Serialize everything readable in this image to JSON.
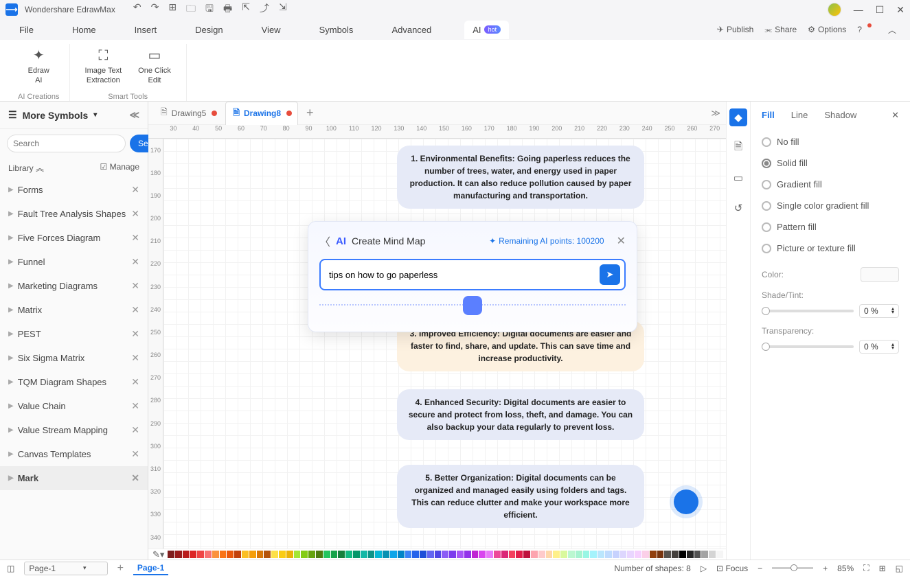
{
  "app": {
    "title": "Wondershare EdrawMax"
  },
  "menu": {
    "items": [
      "File",
      "Home",
      "Insert",
      "Design",
      "View",
      "Symbols",
      "Advanced"
    ],
    "ai_label": "AI",
    "hot": "hot",
    "right": {
      "publish": "Publish",
      "share": "Share",
      "options": "Options"
    }
  },
  "ribbon": {
    "edraw_ai": "Edraw\nAI",
    "group1": "AI Creations",
    "image_text": "Image Text\nExtraction",
    "one_click": "One Click\nEdit",
    "group2": "Smart Tools"
  },
  "sidebar": {
    "title": "More Symbols",
    "search_placeholder": "Search",
    "search_btn": "Search",
    "library": "Library",
    "manage": "Manage",
    "items": [
      "Forms",
      "Fault Tree Analysis Shapes",
      "Five Forces Diagram",
      "Funnel",
      "Marketing Diagrams",
      "Matrix",
      "PEST",
      "Six Sigma Matrix",
      "TQM Diagram Shapes",
      "Value Chain",
      "Value Stream Mapping",
      "Canvas Templates",
      "Mark"
    ]
  },
  "tabs": {
    "t1": "Drawing5",
    "t2": "Drawing8"
  },
  "ruler_h": [
    "30",
    "40",
    "50",
    "60",
    "70",
    "80",
    "90",
    "100",
    "110",
    "120",
    "130",
    "140",
    "150",
    "160",
    "170",
    "180",
    "190",
    "200",
    "210",
    "220",
    "230",
    "240",
    "250",
    "260",
    "270"
  ],
  "ruler_v": [
    "170",
    "180",
    "190",
    "200",
    "210",
    "220",
    "230",
    "240",
    "250",
    "260",
    "270",
    "280",
    "290",
    "300",
    "310",
    "320",
    "330",
    "340"
  ],
  "nodes": {
    "n1": "1. Environmental Benefits: Going paperless reduces the number of trees, water, and energy used in paper production. It can also reduce pollution caused by paper manufacturing and transportation.",
    "n3": "3. Improved Efficiency: Digital documents are easier and faster to find, share, and update. This can save time and increase productivity.",
    "n4": "4. Enhanced Security: Digital documents are easier to secure and protect from loss, theft, and damage. You can also backup your data regularly to prevent loss.",
    "n5": "5. Better Organization: Digital documents can be organized and managed easily using folders and tags. This can reduce clutter and make your workspace more efficient."
  },
  "ai_modal": {
    "title": "Create Mind Map",
    "points": "Remaining AI points: 100200",
    "input": "tips on how to go paperless"
  },
  "props": {
    "tabs": {
      "fill": "Fill",
      "line": "Line",
      "shadow": "Shadow"
    },
    "opts": {
      "nofill": "No fill",
      "solid": "Solid fill",
      "gradient": "Gradient fill",
      "single": "Single color gradient fill",
      "pattern": "Pattern fill",
      "picture": "Picture or texture fill"
    },
    "color": "Color:",
    "shade": "Shade/Tint:",
    "transparency": "Transparency:",
    "shade_val": "0 %",
    "trans_val": "0 %"
  },
  "status": {
    "page_select": "Page-1",
    "page_tab": "Page-1",
    "shapes": "Number of shapes: 8",
    "focus": "Focus",
    "zoom": "85%"
  },
  "colors": [
    "#7f1d1d",
    "#991b1b",
    "#b91c1c",
    "#dc2626",
    "#ef4444",
    "#f87171",
    "#fb923c",
    "#f97316",
    "#ea580c",
    "#c2410c",
    "#fbbf24",
    "#f59e0b",
    "#d97706",
    "#b45309",
    "#fde047",
    "#facc15",
    "#eab308",
    "#a3e635",
    "#84cc16",
    "#65a30d",
    "#4d7c0f",
    "#22c55e",
    "#16a34a",
    "#15803d",
    "#10b981",
    "#059669",
    "#14b8a6",
    "#0d9488",
    "#06b6d4",
    "#0891b2",
    "#0ea5e9",
    "#0284c7",
    "#3b82f6",
    "#2563eb",
    "#1d4ed8",
    "#6366f1",
    "#4f46e5",
    "#8b5cf6",
    "#7c3aed",
    "#a855f7",
    "#9333ea",
    "#c026d3",
    "#d946ef",
    "#e879f9",
    "#ec4899",
    "#db2777",
    "#f43f5e",
    "#e11d48",
    "#be123c",
    "#fda4af",
    "#fecaca",
    "#fed7aa",
    "#fef08a",
    "#d9f99d",
    "#bbf7d0",
    "#a7f3d0",
    "#99f6e4",
    "#a5f3fc",
    "#bae6fd",
    "#bfdbfe",
    "#c7d2fe",
    "#ddd6fe",
    "#e9d5ff",
    "#f5d0fe",
    "#fbcfe8",
    "#92400e",
    "#78350f",
    "#57534e",
    "#44403c",
    "#000000",
    "#262626",
    "#525252",
    "#a3a3a3",
    "#d4d4d4",
    "#f5f5f5"
  ]
}
